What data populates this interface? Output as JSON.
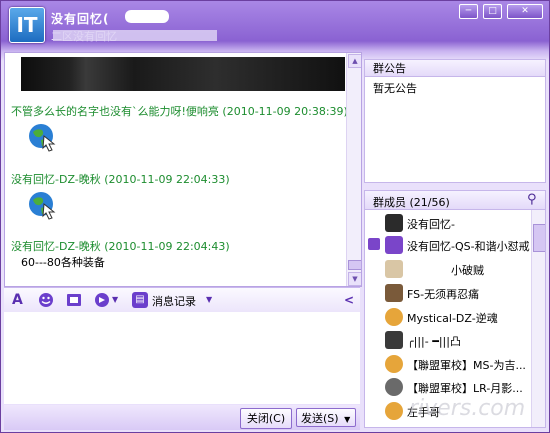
{
  "window": {
    "title": "没有回忆(",
    "subtitle": "二区没有回忆",
    "buttons": {
      "minimize": "─",
      "maximize": "□",
      "close": "✕"
    }
  },
  "chat": {
    "messages": [
      {
        "sender": "不管多么长的名字也没有`么能力呀!便响亮",
        "time": "(2010-11-09 20:38:39)",
        "text": ""
      },
      {
        "sender": "没有回忆-DZ-晚秋",
        "time": "(2010-11-09 22:04:33)",
        "text": ""
      },
      {
        "sender": "没有回忆-DZ-晚秋",
        "time": "(2010-11-09 22:04:43)",
        "text": "60---80各种装备"
      }
    ]
  },
  "toolbar": {
    "font_label": "A",
    "history_label": "消息记录",
    "collapse_label": "<"
  },
  "buttons": {
    "close": "关闭(C)",
    "send": "发送(S)"
  },
  "announcement": {
    "title": "群公告",
    "body": "暂无公告"
  },
  "members": {
    "title": "群成员 (21/56)",
    "items": [
      {
        "name": "没有回忆-",
        "color": "#2b2b2b"
      },
      {
        "name": "没有回忆-QS-和谐小怼戒",
        "color": "#7a45c9"
      },
      {
        "name": "小破贼",
        "color": "#d9c6a5"
      },
      {
        "name": "FS-无须再忍痛",
        "color": "#7a5a3a"
      },
      {
        "name": "Mystical-DZ-逆魂",
        "color": "#e6a53a"
      },
      {
        "name": "╭|||-  ━|||凸",
        "color": "#3a3a3a"
      },
      {
        "name": "【聯盟軍校】MS-为吉...",
        "color": "#e6a53a"
      },
      {
        "name": "【聯盟軍校】LR-月影...",
        "color": "#6a6a6a"
      },
      {
        "name": "左手哥",
        "color": "#e6a53a"
      }
    ]
  },
  "watermark": "rivers.com"
}
